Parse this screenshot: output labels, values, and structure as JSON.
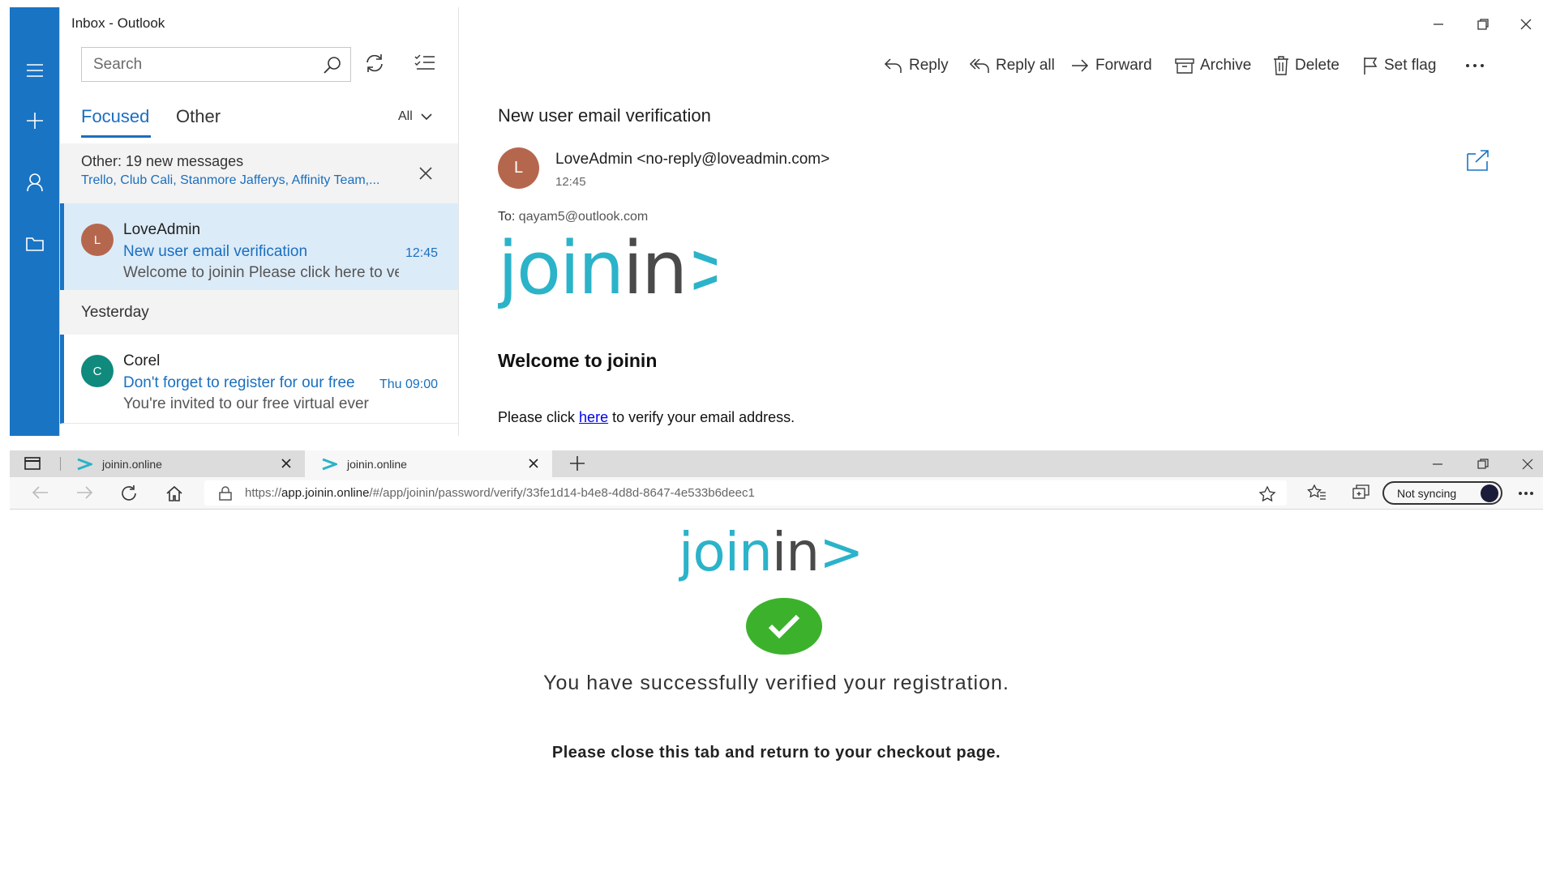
{
  "outlook": {
    "window_title": "Inbox - Outlook",
    "search_placeholder": "Search",
    "tabs": {
      "focused": "Focused",
      "other": "Other"
    },
    "filter_label": "All",
    "other_banner": {
      "title": "Other: 19 new messages",
      "senders": "Trello, Club Cali, Stanmore Jafferys, Affinity Team,..."
    },
    "messages": [
      {
        "avatar_letter": "L",
        "avatar_color": "#b5674e",
        "sender": "LoveAdmin",
        "subject": "New user email verification",
        "time": "12:45",
        "preview": "Welcome to joinin Please click here to ve"
      },
      {
        "avatar_letter": "C",
        "avatar_color": "#0f8a7d",
        "sender": "Corel",
        "subject": "Don't forget to register for our free",
        "time": "Thu 09:00",
        "preview": "You're invited to our free virtual ever"
      }
    ],
    "group_yesterday": "Yesterday",
    "toolbar": {
      "reply": "Reply",
      "reply_all": "Reply all",
      "forward": "Forward",
      "archive": "Archive",
      "delete": "Delete",
      "set_flag": "Set flag"
    },
    "email": {
      "subject": "New user email verification",
      "avatar_letter": "L",
      "from": "LoveAdmin <no-reply@loveadmin.com>",
      "time": "12:45",
      "to_label": "To:",
      "to_address": "qayam5@outlook.com",
      "logo_text_a": "join",
      "logo_text_b": "in",
      "logo_text_c": ">",
      "welcome_heading": "Welcome to joinin",
      "verify_before": "Please click ",
      "verify_link": "here",
      "verify_after": " to verify your email address."
    }
  },
  "browser": {
    "tabs": [
      {
        "title": "joinin.online"
      },
      {
        "title": "joinin.online"
      }
    ],
    "url_prefix": "https://",
    "url_host": "app.joinin.online",
    "url_path": "/#/app/joinin/password/verify/33fe1d14-b4e8-4d8d-8647-4e533b6deec1",
    "sync_label": "Not syncing",
    "page": {
      "logo_text_a": "join",
      "logo_text_b": "in",
      "logo_text_c": ">",
      "success_message": "You have successfully verified your registration.",
      "close_message": "Please close this tab and return to your checkout page."
    }
  },
  "colors": {
    "outlook_blue": "#1a74c4",
    "joinin_teal": "#2bb3c9",
    "joinin_dark": "#4a4a4a",
    "success_green": "#3cb22c"
  }
}
